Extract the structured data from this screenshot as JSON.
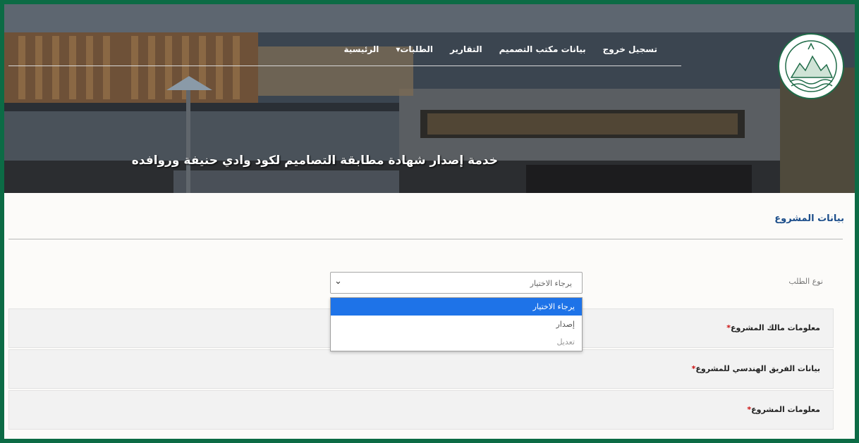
{
  "nav": {
    "home": "الرئيسية",
    "requests": "الطلبات▾",
    "reports": "التقارير",
    "office_data": "بيانات مكتب التصميم",
    "logout": "تسجيل خروج"
  },
  "hero": {
    "title": "خدمة إصدار شهادة مطابقة التصاميم لكود وادي حنيفة وروافده"
  },
  "section": {
    "title": "بيانات المشروع"
  },
  "request_type": {
    "label": "نوع الطلب",
    "selected_value": "يرجاء الاختيار",
    "options": [
      "يرجاء الاختيار",
      "إصدار",
      "تعديل"
    ]
  },
  "panels": [
    {
      "label": "معلومات مالك المشروع",
      "required_mark": "*"
    },
    {
      "label": "بيانات الفريق الهندسي للمشروع",
      "required_mark": "*"
    },
    {
      "label": "معلومات المشروع",
      "required_mark": "*"
    }
  ],
  "colors": {
    "frame_border": "#0c6b45",
    "section_title": "#1b4d8a",
    "selected_option": "#1e73e8",
    "arrow": "#d42020",
    "required": "#cc1111"
  },
  "icons": {
    "logo": "authority-emblem-icon",
    "dropdown": "chevron-down-icon",
    "pointer": "red-arrow-icon"
  }
}
